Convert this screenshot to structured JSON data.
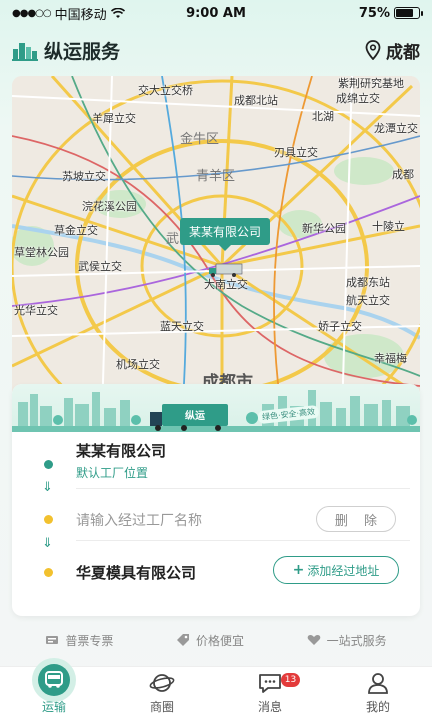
{
  "status_bar": {
    "carrier": "中国移动",
    "time": "9:00 AM",
    "battery": "75%",
    "battery_level": 0.75
  },
  "header": {
    "title": "纵运服务",
    "city": "成都"
  },
  "map": {
    "company_bubble": "某某有限公司",
    "districts": [
      "金牛区",
      "青羊区",
      "武",
      "成都市"
    ],
    "labels": [
      "交大立交桥",
      "羊犀立交",
      "成都北站",
      "紫荆研究基地",
      "成绵立交",
      "北湖",
      "龙潭立交",
      "刃具立交",
      "成都",
      "苏坡立交",
      "浣花溪公园",
      "新华公园",
      "草金立交",
      "十陵立",
      "草堂林公园",
      "武侯立交",
      "成都东站",
      "大南立交",
      "航天立交",
      "光华立交",
      "蓝天立交",
      "娇子立交",
      "机场立交",
      "幸福梅"
    ]
  },
  "card": {
    "banner_slogan": "绿色·安全·高效",
    "banner_truck_text": "纵运",
    "origin": {
      "title": "某某有限公司",
      "subtitle": "默认工厂位置"
    },
    "waypoint": {
      "placeholder": "请输入经过工厂名称",
      "delete_label": "删 除"
    },
    "destination": {
      "title": "华夏模具有限公司",
      "add_label": "添加经过地址"
    },
    "arrow": "⇓"
  },
  "features": [
    {
      "icon": "ticket-icon",
      "label": "普票专票"
    },
    {
      "icon": "tag-icon",
      "label": "价格便宜"
    },
    {
      "icon": "heart-icon",
      "label": "一站式服务"
    }
  ],
  "tabbar": [
    {
      "label": "运输",
      "icon": "bus-icon",
      "active": true
    },
    {
      "label": "商圈",
      "icon": "planet-icon",
      "active": false
    },
    {
      "label": "消息",
      "icon": "chat-icon",
      "active": false,
      "badge": "13"
    },
    {
      "label": "我的",
      "icon": "user-icon",
      "active": false
    }
  ],
  "colors": {
    "accent": "#2f9c88",
    "waypoint_dot": "#f2c12e",
    "badge": "#e33b3b"
  }
}
